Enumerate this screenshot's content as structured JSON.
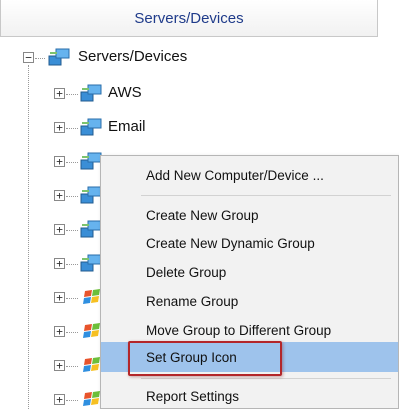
{
  "header": {
    "title": "Servers/Devices"
  },
  "tree": {
    "root": {
      "label": "Servers/Devices",
      "expander": "−",
      "icon": "server-group-icon"
    },
    "children": [
      {
        "label": "AWS",
        "expander": "+",
        "icon": "server-group-icon"
      },
      {
        "label": "Email",
        "expander": "+",
        "icon": "server-group-icon"
      },
      {
        "label": "",
        "expander": "+",
        "icon": "server-group-icon"
      },
      {
        "label": "",
        "expander": "+",
        "icon": "server-group-icon"
      },
      {
        "label": "",
        "expander": "+",
        "icon": "server-group-icon"
      },
      {
        "label": "",
        "expander": "+",
        "icon": "server-group-icon"
      },
      {
        "label": "",
        "expander": "+",
        "icon": "windows-flag-icon"
      },
      {
        "label": "",
        "expander": "+",
        "icon": "windows-flag-icon"
      },
      {
        "label": "",
        "expander": "+",
        "icon": "windows-flag-icon"
      },
      {
        "label": "",
        "expander": "+",
        "icon": "windows-flag-icon"
      }
    ]
  },
  "context_menu": {
    "items": [
      {
        "label": "Add New Computer/Device ..."
      },
      {
        "label": "Create New Group"
      },
      {
        "label": "Create New Dynamic Group"
      },
      {
        "label": "Delete Group"
      },
      {
        "label": "Rename Group"
      },
      {
        "label": "Move Group to Different Group"
      },
      {
        "label": "Set Group Icon",
        "active": true
      },
      {
        "label": "Report Settings"
      }
    ]
  },
  "colors": {
    "header_text": "#1f3b8a",
    "menu_highlight": "#9ec3ec",
    "callout_border": "#b3262a"
  }
}
